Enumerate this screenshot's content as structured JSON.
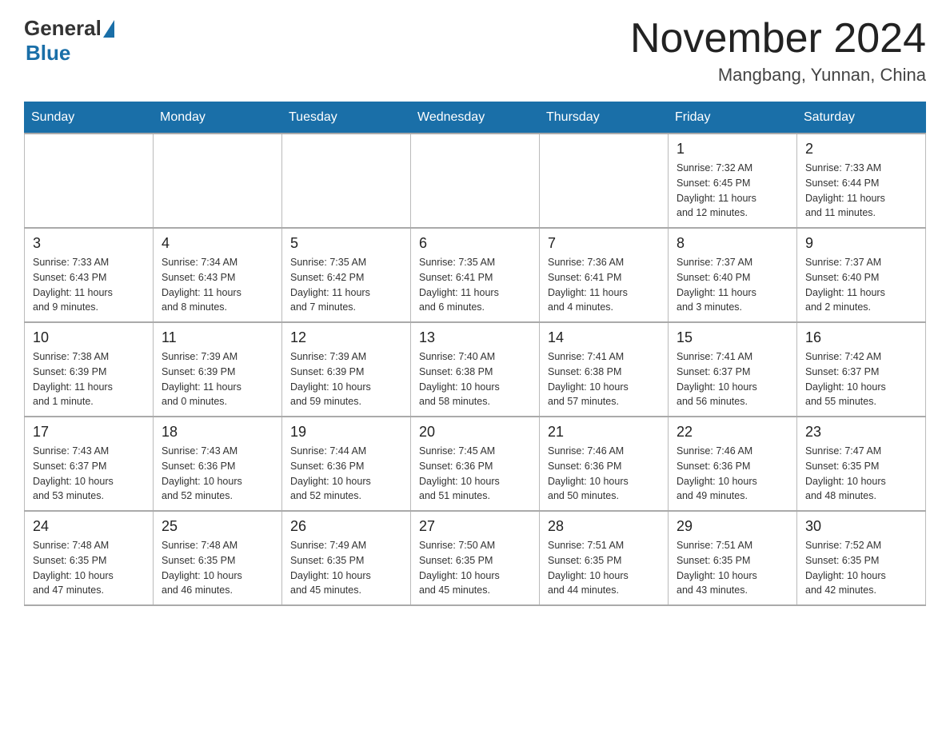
{
  "header": {
    "logo_general": "General",
    "logo_blue": "Blue",
    "month_title": "November 2024",
    "location": "Mangbang, Yunnan, China"
  },
  "weekdays": [
    "Sunday",
    "Monday",
    "Tuesday",
    "Wednesday",
    "Thursday",
    "Friday",
    "Saturday"
  ],
  "weeks": [
    [
      {
        "day": "",
        "info": ""
      },
      {
        "day": "",
        "info": ""
      },
      {
        "day": "",
        "info": ""
      },
      {
        "day": "",
        "info": ""
      },
      {
        "day": "",
        "info": ""
      },
      {
        "day": "1",
        "info": "Sunrise: 7:32 AM\nSunset: 6:45 PM\nDaylight: 11 hours\nand 12 minutes."
      },
      {
        "day": "2",
        "info": "Sunrise: 7:33 AM\nSunset: 6:44 PM\nDaylight: 11 hours\nand 11 minutes."
      }
    ],
    [
      {
        "day": "3",
        "info": "Sunrise: 7:33 AM\nSunset: 6:43 PM\nDaylight: 11 hours\nand 9 minutes."
      },
      {
        "day": "4",
        "info": "Sunrise: 7:34 AM\nSunset: 6:43 PM\nDaylight: 11 hours\nand 8 minutes."
      },
      {
        "day": "5",
        "info": "Sunrise: 7:35 AM\nSunset: 6:42 PM\nDaylight: 11 hours\nand 7 minutes."
      },
      {
        "day": "6",
        "info": "Sunrise: 7:35 AM\nSunset: 6:41 PM\nDaylight: 11 hours\nand 6 minutes."
      },
      {
        "day": "7",
        "info": "Sunrise: 7:36 AM\nSunset: 6:41 PM\nDaylight: 11 hours\nand 4 minutes."
      },
      {
        "day": "8",
        "info": "Sunrise: 7:37 AM\nSunset: 6:40 PM\nDaylight: 11 hours\nand 3 minutes."
      },
      {
        "day": "9",
        "info": "Sunrise: 7:37 AM\nSunset: 6:40 PM\nDaylight: 11 hours\nand 2 minutes."
      }
    ],
    [
      {
        "day": "10",
        "info": "Sunrise: 7:38 AM\nSunset: 6:39 PM\nDaylight: 11 hours\nand 1 minute."
      },
      {
        "day": "11",
        "info": "Sunrise: 7:39 AM\nSunset: 6:39 PM\nDaylight: 11 hours\nand 0 minutes."
      },
      {
        "day": "12",
        "info": "Sunrise: 7:39 AM\nSunset: 6:39 PM\nDaylight: 10 hours\nand 59 minutes."
      },
      {
        "day": "13",
        "info": "Sunrise: 7:40 AM\nSunset: 6:38 PM\nDaylight: 10 hours\nand 58 minutes."
      },
      {
        "day": "14",
        "info": "Sunrise: 7:41 AM\nSunset: 6:38 PM\nDaylight: 10 hours\nand 57 minutes."
      },
      {
        "day": "15",
        "info": "Sunrise: 7:41 AM\nSunset: 6:37 PM\nDaylight: 10 hours\nand 56 minutes."
      },
      {
        "day": "16",
        "info": "Sunrise: 7:42 AM\nSunset: 6:37 PM\nDaylight: 10 hours\nand 55 minutes."
      }
    ],
    [
      {
        "day": "17",
        "info": "Sunrise: 7:43 AM\nSunset: 6:37 PM\nDaylight: 10 hours\nand 53 minutes."
      },
      {
        "day": "18",
        "info": "Sunrise: 7:43 AM\nSunset: 6:36 PM\nDaylight: 10 hours\nand 52 minutes."
      },
      {
        "day": "19",
        "info": "Sunrise: 7:44 AM\nSunset: 6:36 PM\nDaylight: 10 hours\nand 52 minutes."
      },
      {
        "day": "20",
        "info": "Sunrise: 7:45 AM\nSunset: 6:36 PM\nDaylight: 10 hours\nand 51 minutes."
      },
      {
        "day": "21",
        "info": "Sunrise: 7:46 AM\nSunset: 6:36 PM\nDaylight: 10 hours\nand 50 minutes."
      },
      {
        "day": "22",
        "info": "Sunrise: 7:46 AM\nSunset: 6:36 PM\nDaylight: 10 hours\nand 49 minutes."
      },
      {
        "day": "23",
        "info": "Sunrise: 7:47 AM\nSunset: 6:35 PM\nDaylight: 10 hours\nand 48 minutes."
      }
    ],
    [
      {
        "day": "24",
        "info": "Sunrise: 7:48 AM\nSunset: 6:35 PM\nDaylight: 10 hours\nand 47 minutes."
      },
      {
        "day": "25",
        "info": "Sunrise: 7:48 AM\nSunset: 6:35 PM\nDaylight: 10 hours\nand 46 minutes."
      },
      {
        "day": "26",
        "info": "Sunrise: 7:49 AM\nSunset: 6:35 PM\nDaylight: 10 hours\nand 45 minutes."
      },
      {
        "day": "27",
        "info": "Sunrise: 7:50 AM\nSunset: 6:35 PM\nDaylight: 10 hours\nand 45 minutes."
      },
      {
        "day": "28",
        "info": "Sunrise: 7:51 AM\nSunset: 6:35 PM\nDaylight: 10 hours\nand 44 minutes."
      },
      {
        "day": "29",
        "info": "Sunrise: 7:51 AM\nSunset: 6:35 PM\nDaylight: 10 hours\nand 43 minutes."
      },
      {
        "day": "30",
        "info": "Sunrise: 7:52 AM\nSunset: 6:35 PM\nDaylight: 10 hours\nand 42 minutes."
      }
    ]
  ]
}
